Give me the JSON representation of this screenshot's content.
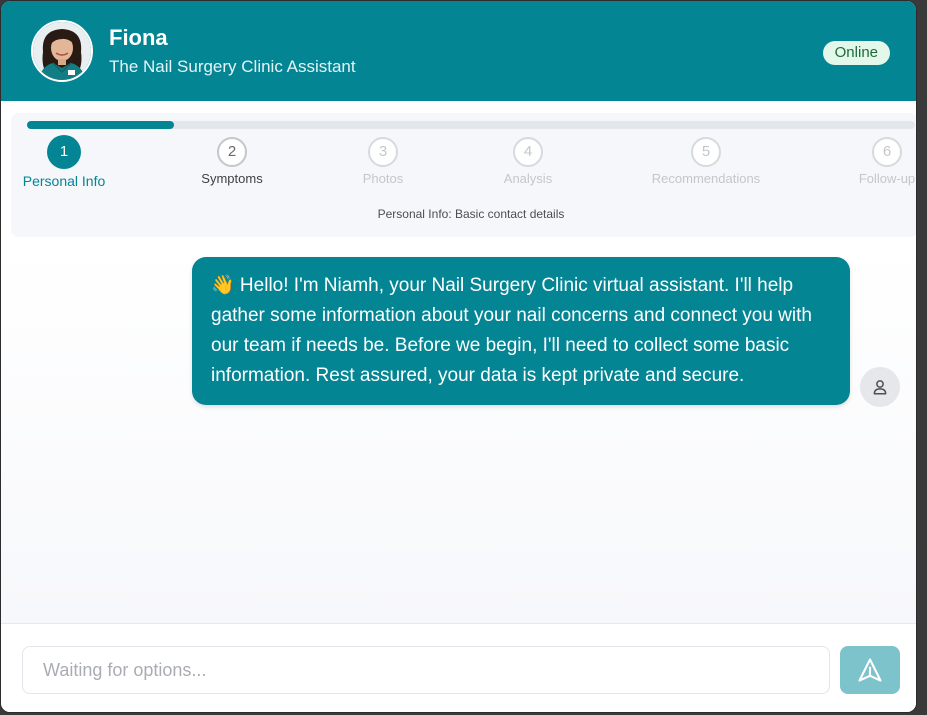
{
  "header": {
    "bot_name": "Fiona",
    "bot_subtitle": "The Nail Surgery Clinic Assistant",
    "status": "Online"
  },
  "progress": {
    "fraction": 0.166,
    "steps": [
      {
        "number": "1",
        "label": "Personal Info",
        "state": "active"
      },
      {
        "number": "2",
        "label": "Symptoms",
        "state": "next"
      },
      {
        "number": "3",
        "label": "Photos",
        "state": "pending"
      },
      {
        "number": "4",
        "label": "Analysis",
        "state": "pending"
      },
      {
        "number": "5",
        "label": "Recommendations",
        "state": "pending"
      },
      {
        "number": "6",
        "label": "Follow-up",
        "state": "pending"
      }
    ],
    "description": "Personal Info: Basic contact details"
  },
  "chat": {
    "messages": [
      {
        "text": "👋 Hello! I'm Niamh, your Nail Surgery Clinic virtual assistant. I'll help gather some information about your nail concerns and connect you with our team if needs be. Before we begin, I'll need to collect some basic information. Rest assured, your data is kept private and secure."
      }
    ]
  },
  "input": {
    "placeholder": "Waiting for options...",
    "value": ""
  },
  "icons": {
    "avatar": "assistant-avatar",
    "user": "user-icon",
    "send": "send-icon"
  },
  "colors": {
    "brand": "#048594",
    "status_bg": "#e3f7ea",
    "send_disabled": "#7cc3cb"
  }
}
